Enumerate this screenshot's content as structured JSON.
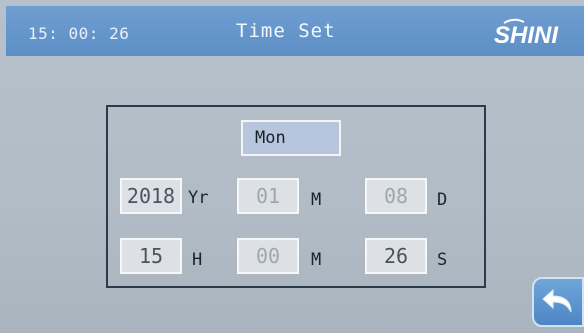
{
  "header": {
    "clock": "15: 00: 26",
    "title": "Time Set",
    "logo_text": "SHINI"
  },
  "weekday": "Mon",
  "date": {
    "year": "2018",
    "year_unit": "Yr",
    "month": "01",
    "month_unit": "M",
    "day": "08",
    "day_unit": "D"
  },
  "time": {
    "hour": "15",
    "hour_unit": "H",
    "minute": "00",
    "minute_unit": "M",
    "second": "26",
    "second_unit": "S"
  },
  "icons": {
    "back": "back-arrow-icon"
  },
  "colors": {
    "title_bar": "#5d8fc6",
    "background": "#b4bec8",
    "weekday_field": "#b7c6dc",
    "input_field": "#dde1e5"
  }
}
